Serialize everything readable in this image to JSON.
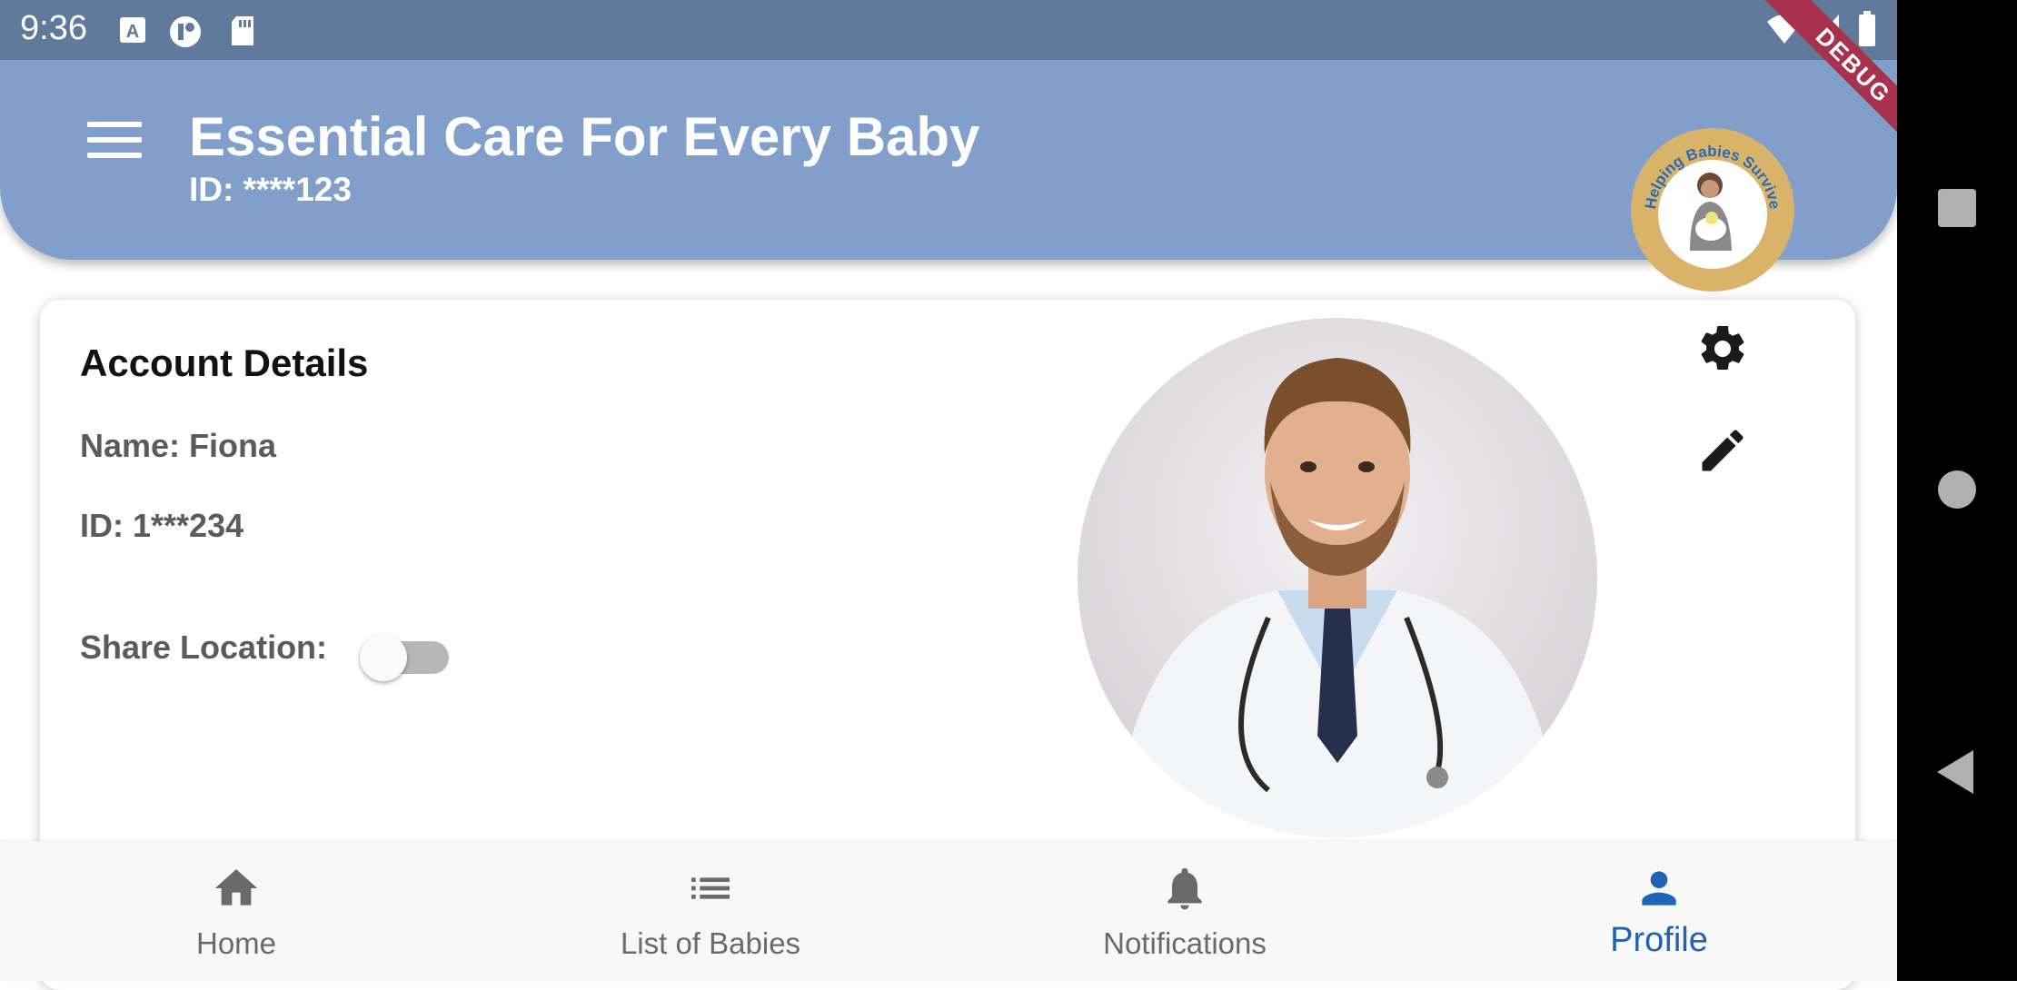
{
  "status_bar": {
    "time": "9:36",
    "left_icons": [
      "keyboard-a-icon",
      "app-circle-icon",
      "sd-card-icon"
    ],
    "right_icons": [
      "wifi-icon",
      "signal-icon",
      "battery-icon"
    ]
  },
  "debug_banner": "DEBUG",
  "app_bar": {
    "title": "Essential Care For Every Baby",
    "subtitle": "ID: ****123",
    "menu_icon": "hamburger-menu-icon",
    "logo_text": "Helping Babies Survive",
    "background": "#819fca"
  },
  "account_card": {
    "title": "Account Details",
    "name_line": "Name: Fiona",
    "id_line": "ID: 1***234",
    "share_location_label": "Share Location:",
    "share_location_enabled": false,
    "settings_icon": "gear-icon",
    "edit_icon": "pencil-icon"
  },
  "bottom_nav": {
    "items": [
      {
        "label": "Home",
        "icon": "home-icon",
        "active": false
      },
      {
        "label": "List of Babies",
        "icon": "list-icon",
        "active": false
      },
      {
        "label": "Notifications",
        "icon": "bell-icon",
        "active": false
      },
      {
        "label": "Profile",
        "icon": "person-icon",
        "active": true
      }
    ],
    "active_color": "#1f62b6",
    "inactive_color": "#6a6a6a"
  }
}
